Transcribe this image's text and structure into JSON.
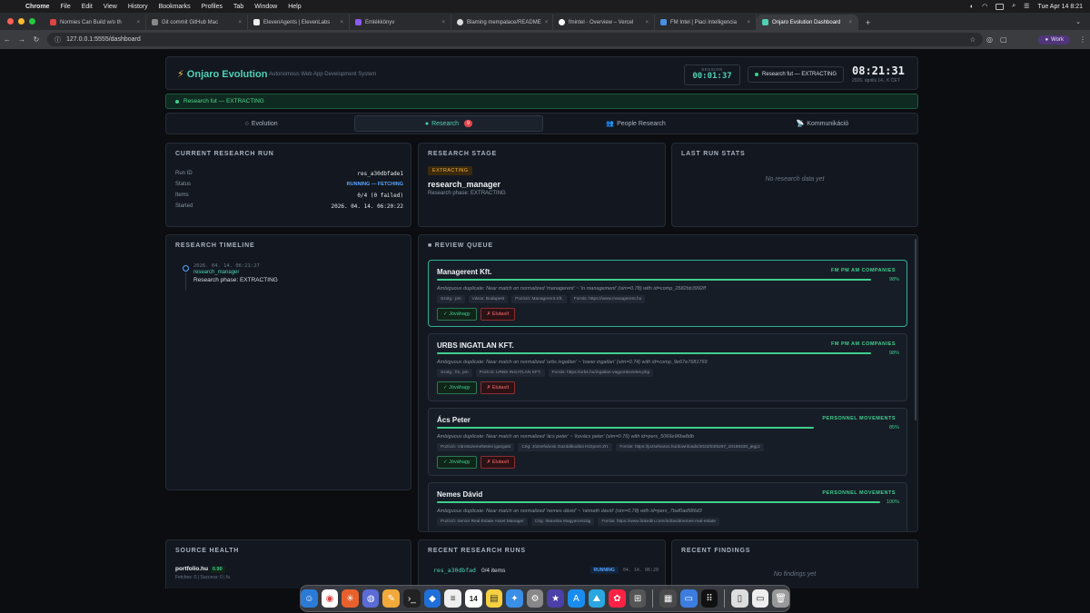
{
  "menubar": {
    "app": "Chrome",
    "items": [
      "File",
      "Edit",
      "View",
      "History",
      "Bookmarks",
      "Profiles",
      "Tab",
      "Window",
      "Help"
    ],
    "datetime": "Tue Apr 14  8:21"
  },
  "browser": {
    "tabs": [
      {
        "title": "Normies Can Build w/o th",
        "color": "#d44"
      },
      {
        "title": "Git commit GitHub Mac",
        "color": "#888"
      },
      {
        "title": "ElevenAgents | ElevenLabs",
        "color": "#eee"
      },
      {
        "title": "Emlékkönyv",
        "color": "#8a5cf6"
      },
      {
        "title": "Blaming mempalace/README",
        "color": "#ddd"
      },
      {
        "title": "fmintel - Overview – Vercel",
        "color": "#fff"
      },
      {
        "title": "FM Intel | Piaci Intelligencia",
        "color": "#4a90e2"
      },
      {
        "title": "Onjaro Evolution Dashboard",
        "color": "#4fd1b5"
      }
    ],
    "url": "127.0.0.1:5555/dashboard",
    "profile": "Work"
  },
  "header": {
    "title": "Onjaro Evolution",
    "tagline": "Autonomous Web App Development System",
    "session_label": "SESSION",
    "session_value": "00:01:37",
    "research_status": "Research fut — EXTRACTING",
    "clock": "08:21:31",
    "date": "2026. április 14., K CET"
  },
  "banner": "Research fut — EXTRACTING",
  "nav_tabs": [
    {
      "icon": "○",
      "label": "Evolution"
    },
    {
      "icon": "●",
      "label": "Research",
      "badge": "9"
    },
    {
      "icon": "👥",
      "label": "People Research"
    },
    {
      "icon": "📡",
      "label": "Kommunikáció"
    }
  ],
  "current_run": {
    "title": "CURRENT RESEARCH RUN",
    "rows": [
      {
        "k": "Run ID",
        "v": "res_a30dbfade1"
      },
      {
        "k": "Status",
        "v": "RUNNING — FETCHING"
      },
      {
        "k": "Items",
        "v": "0/4 (0 failed)"
      },
      {
        "k": "Started",
        "v": "2026. 04. 14. 06:20:22"
      }
    ]
  },
  "stage": {
    "title": "RESEARCH STAGE",
    "pill": "EXTRACTING",
    "name": "research_manager",
    "phase": "Research phase: EXTRACTING"
  },
  "last_stats": {
    "title": "LAST RUN STATS",
    "empty": "No research data yet"
  },
  "timeline": {
    "title": "RESEARCH TIMELINE",
    "time": "2026. 04. 14. 06:21:27",
    "name": "research_manager",
    "desc": "Research phase: EXTRACTING"
  },
  "queue": {
    "title": "REVIEW QUEUE",
    "approve": "✓ Jóváhagy",
    "reject": "✗ Elutasít",
    "items": [
      {
        "title": "Managerent Kft.",
        "category": "FM PM AM COMPANIES",
        "pct": "98%",
        "confidence": 0.98,
        "ambiguous": "Ambiguous duplicate: Near match on normalized 'managerent' ~ 'in management' (sim=0.78) with id=comp_2582bb3992ff",
        "chips": [
          "Szolg.: pm",
          "Város: Budapest",
          "Pozíció: Managerent Kft.",
          "Forrás: https://www.managerent.hu"
        ]
      },
      {
        "title": "URBS INGATLAN KFT.",
        "category": "FM PM AM COMPANIES",
        "pct": "98%",
        "confidence": 0.98,
        "ambiguous": "Ambiguous duplicate: Near match on normalized 'urbs ingatlan' ~ 'tower ingatlan' (sim=0.74) with id=comp_9e67e7681769",
        "chips": [
          "Szolg.: fm, pm",
          "Pozíció: URBS INGATLAN KFT.",
          "Forrás: https://urbs.hu/ingatlan-vagyonkezeles.php"
        ]
      },
      {
        "title": "Ács Peter",
        "category": "PERSONNEL MOVEMENTS",
        "pct": "85%",
        "confidence": 0.85,
        "ambiguous": "Ambiguous duplicate: Near match on normalized 'ács peter' ~ 'kovács peter' (sim=0.76) with id=pers_5066e96ba8db",
        "chips": [
          "Pozíció: Városüzemeltetési igazgató",
          "Cég: Józsefvárosi Gazdálkodási Központ Zrt.",
          "Forrás: https://jozsefvaros.hu/downloads/2022/03/6297_20190430_jegyz"
        ]
      },
      {
        "title": "Nemes Dávid",
        "category": "PERSONNEL MOVEMENTS",
        "pct": "100%",
        "confidence": 1.0,
        "ambiguous": "Ambiguous duplicate: Near match on normalized 'nemes dávid' ~ 'németh dávid' (sim=0.78) with id=pers_7baf0ad586d3",
        "chips": [
          "Pozíció: Senior Real Estate Asset Manager",
          "Cég: Skanska Magyarország",
          "Forrás: https://www.linkedin.com/in/davidnemes-real-estate"
        ]
      }
    ]
  },
  "source_health": {
    "title": "SOURCE HEALTH",
    "name": "portfolio.hu",
    "score": "0.90",
    "sub": "Fetches: 0 | Success: 0 | fu"
  },
  "recent_runs": {
    "title": "RECENT RESEARCH RUNS",
    "id": "res_a30dbfad",
    "items": "0/4 items",
    "status": "RUNNING",
    "time": "04. 14. 06:20"
  },
  "recent_findings": {
    "title": "RECENT FINDINGS",
    "empty": "No findings yet"
  },
  "dock_date": "14"
}
